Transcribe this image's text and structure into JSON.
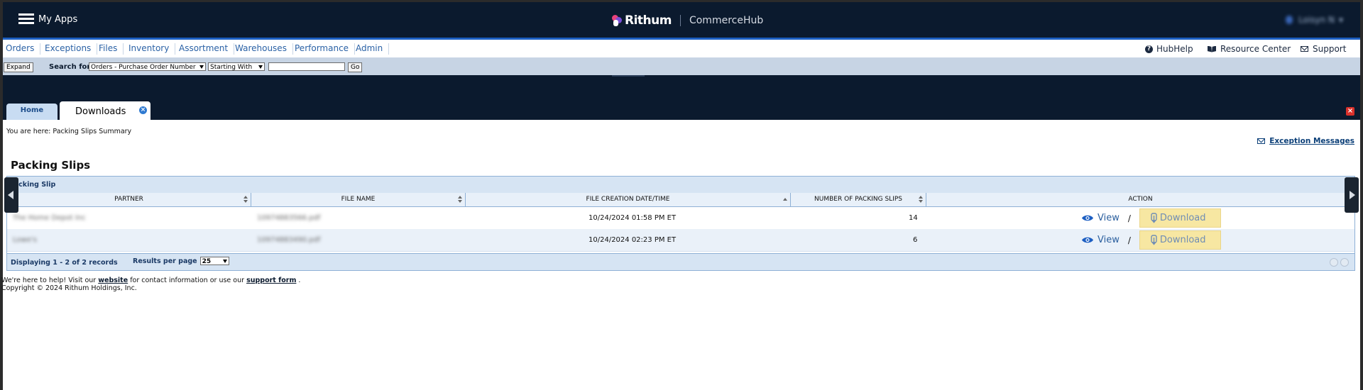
{
  "header": {
    "menu_label": "My Apps",
    "brand": "Rithum",
    "product": "CommerceHub",
    "user_name": "Loisyn N"
  },
  "nav": {
    "items": [
      "Orders",
      "Exceptions",
      "Files",
      "Inventory",
      "Assortment",
      "Warehouses",
      "Performance",
      "Admin"
    ],
    "right": {
      "help": "HubHelp",
      "resources": "Resource Center",
      "support": "Support"
    }
  },
  "search": {
    "expand": "Expand",
    "label": "Search for",
    "field_value": "Orders - Purchase Order Number",
    "mode_value": "Starting With",
    "query_value": "",
    "go": "Go"
  },
  "tabs": {
    "home": "Home",
    "active": "Downloads",
    "close_glyph": "×"
  },
  "page": {
    "breadcrumb": "You are here: Packing Slips Summary",
    "exception_link": "Exception Messages",
    "title": "Packing Slips"
  },
  "grid": {
    "caption": "Packing Slip",
    "columns": [
      "PARTNER",
      "FILE NAME",
      "FILE CREATION DATE/TIME",
      "NUMBER OF PACKING SLIPS",
      "ACTION"
    ],
    "rows": [
      {
        "partner": "The Home Depot Inc",
        "file_name": "10974883566.pdf",
        "created": "10/24/2024 01:58 PM ET",
        "count": "14",
        "view": "View",
        "sep": "/",
        "download": "Download"
      },
      {
        "partner": "Lowe's",
        "file_name": "10974883490.pdf",
        "created": "10/24/2024 02:23 PM ET",
        "count": "6",
        "view": "View",
        "sep": "/",
        "download": "Download"
      }
    ],
    "footer": {
      "displaying": "Displaying 1 - 2 of 2 records",
      "rpp_label": "Results per page",
      "rpp_value": "25"
    }
  },
  "footer": {
    "line1_pre": "We're here to help! Visit our",
    "website": "website",
    "line1_mid": "for contact information or use our",
    "support_form": "support form",
    "line1_end": ".",
    "copyright": "Copyright © 2024 Rithum Holdings, Inc."
  },
  "colors": {
    "header_bg": "#0b1a2e",
    "accent_blue": "#1d5fc2",
    "highlight": "#f7e7a2",
    "grid_border": "#8fb1d6"
  }
}
